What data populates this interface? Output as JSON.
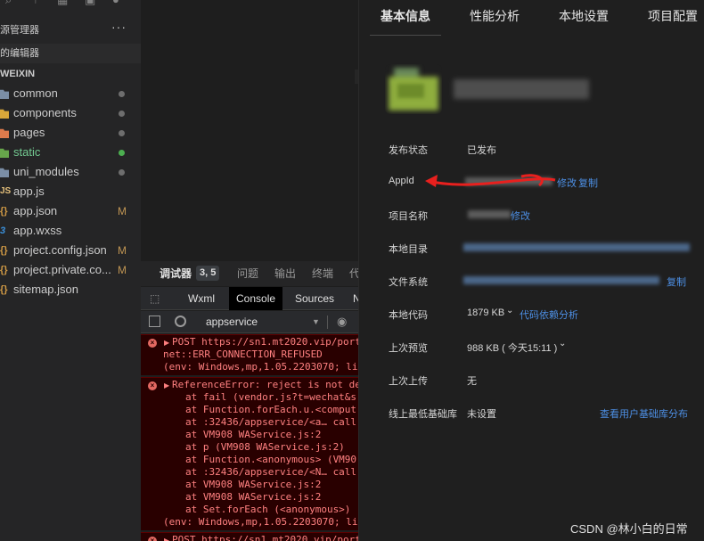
{
  "explorer": {
    "title": "源管理器",
    "more": "···",
    "open_editors": "的编辑器",
    "project": "WEIXIN",
    "items": [
      {
        "label": "common",
        "icon": "folder-icon",
        "marker": "dot",
        "marker_color": "#6e6e6e",
        "icon_color": "#7b8ea6"
      },
      {
        "label": "components",
        "icon": "folder-icon",
        "marker": "dot",
        "marker_color": "#6e6e6e",
        "icon_color": "#d9a73a"
      },
      {
        "label": "pages",
        "icon": "folder-icon",
        "marker": "dot",
        "marker_color": "#6e6e6e",
        "icon_color": "#dd7a4c"
      },
      {
        "label": "static",
        "icon": "folder-icon",
        "marker": "dot",
        "marker_color": "#4caf50",
        "icon_color": "#67a64b",
        "label_color": "#73c991"
      },
      {
        "label": "uni_modules",
        "icon": "folder-icon",
        "marker": "dot",
        "marker_color": "#6e6e6e",
        "icon_color": "#7b8ea6"
      },
      {
        "label": "app.js",
        "icon": "js-file-icon",
        "marker": "",
        "icon_text": "JS"
      },
      {
        "label": "app.json",
        "icon": "json-file-icon",
        "marker": "M",
        "icon_text": "{}"
      },
      {
        "label": "app.wxss",
        "icon": "wxss-file-icon",
        "marker": "",
        "icon_text": "3"
      },
      {
        "label": "project.config.json",
        "icon": "json-file-icon",
        "marker": "M",
        "icon_text": "{}"
      },
      {
        "label": "project.private.co...",
        "icon": "json-file-icon",
        "marker": "M",
        "icon_text": "{}"
      },
      {
        "label": "sitemap.json",
        "icon": "json-file-icon",
        "marker": "",
        "icon_text": "{}"
      }
    ]
  },
  "debug": {
    "tabs": {
      "debugger": "调试器",
      "badge": "3, 5",
      "issues": "问题",
      "output": "输出",
      "terminal": "终端",
      "more": "代"
    },
    "devtools": {
      "wxml": "Wxml",
      "console": "Console",
      "sources": "Sources",
      "network_cut": "N"
    },
    "context": "appservice",
    "console_lines": [
      {
        "text": "POST https://sn1.mt2020.vip/port",
        "indent": 0,
        "first": true
      },
      {
        "text": "net::ERR_CONNECTION_REFUSED",
        "indent": 1
      },
      {
        "text": "(env: Windows,mp,1.05.2203070; lib",
        "indent": 1
      },
      {
        "text": "ReferenceError: reject is not de",
        "indent": 0,
        "first": true
      },
      {
        "text": "at fail (vendor.js?t=wechat&s",
        "indent": 2
      },
      {
        "text": "at Function.forEach.u.<comput",
        "indent": 2
      },
      {
        "text": "at :32436/appservice/<a… call",
        "indent": 2
      },
      {
        "text": "at VM908 WAService.js:2",
        "indent": 2
      },
      {
        "text": "at p (VM908 WAService.js:2)",
        "indent": 2
      },
      {
        "text": "at Function.<anonymous> (VM90",
        "indent": 2
      },
      {
        "text": "at :32436/appservice/<N… call",
        "indent": 2
      },
      {
        "text": "at VM908 WAService.js:2",
        "indent": 2
      },
      {
        "text": "at VM908 WAService.js:2",
        "indent": 2
      },
      {
        "text": "at Set.forEach (<anonymous>)",
        "indent": 2
      },
      {
        "text": "(env: Windows,mp,1.05.2203070; lib",
        "indent": 1
      },
      {
        "text": "POST https://sn1.mt2020.vip/port",
        "indent": 0,
        "first": true
      }
    ]
  },
  "details": {
    "tabs": [
      "基本信息",
      "性能分析",
      "本地设置",
      "项目配置"
    ],
    "rows": {
      "status_label": "发布状态",
      "status_value": "已发布",
      "appid_label": "AppId",
      "appid_edit": "修改",
      "appid_copy": "复制",
      "name_label": "项目名称",
      "name_edit": "修改",
      "dir_label": "本地目录",
      "fs_label": "文件系统",
      "fs_link": "复制",
      "code_label": "本地代码",
      "code_value": "1879 KB",
      "code_link": "代码依赖分析",
      "preview_label": "上次预览",
      "preview_value": "988 KB ( 今天15:11 )",
      "upload_label": "上次上传",
      "upload_value": "无",
      "lib_label": "线上最低基础库",
      "lib_value": "未设置",
      "lib_link": "查看用户基础库分布"
    }
  },
  "watermark": "CSDN @林小白的日常"
}
